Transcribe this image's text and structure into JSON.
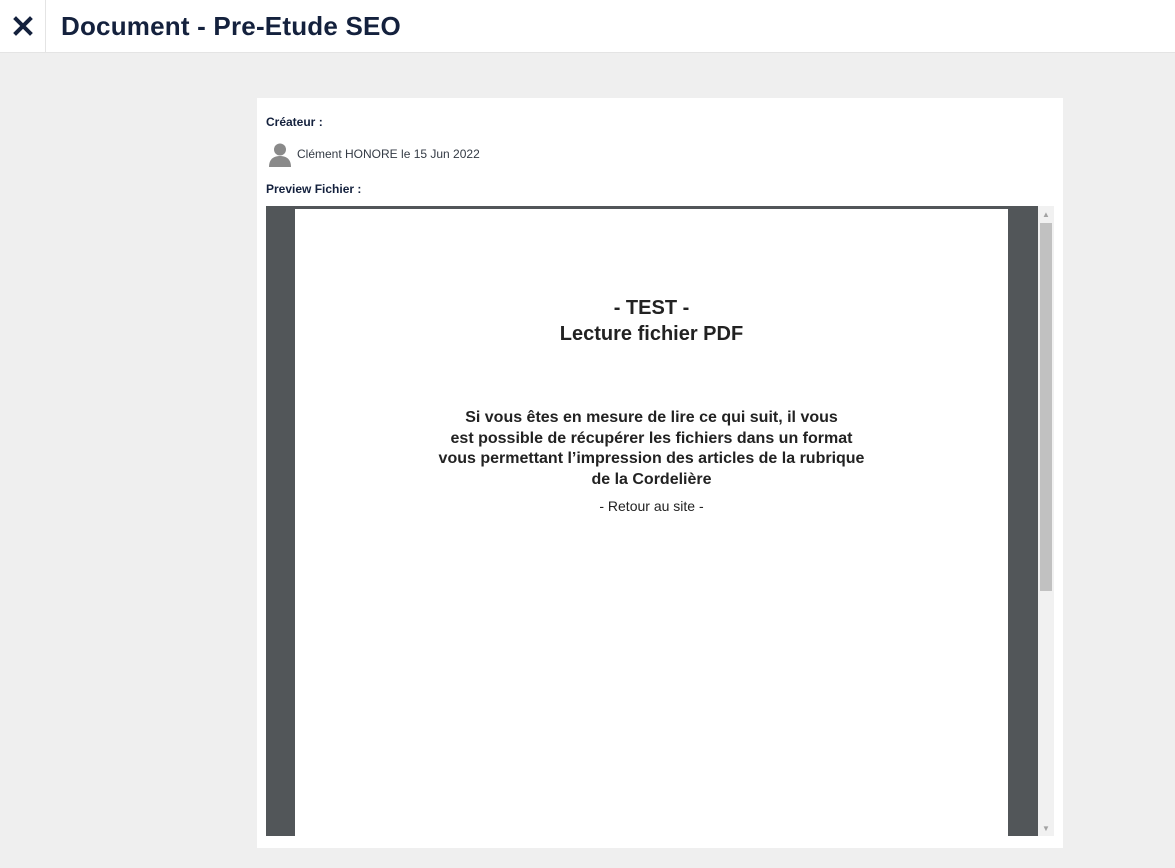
{
  "header": {
    "title": "Document - Pre-Etude SEO",
    "close_icon": "close-icon"
  },
  "card": {
    "creator_label": "Créateur :",
    "creator_text": "Clément HONORE le 15 Jun 2022",
    "avatar_icon": "user-avatar-icon",
    "preview_label": "Preview Fichier :"
  },
  "pdf": {
    "title_line1": "- TEST -",
    "title_line2": "Lecture fichier PDF",
    "body_line1": "Si vous êtes en mesure de lire ce qui suit, il vous",
    "body_line2": "est possible de récupérer les fichiers dans un format",
    "body_line3": "vous permettant l’impression des articles de la rubrique",
    "body_line4": "de la Cordelière",
    "link": "- Retour au site -"
  },
  "scrollbar": {
    "up_glyph": "▲",
    "down_glyph": "▼"
  },
  "colors": {
    "title": "#14213d",
    "background": "#efefef",
    "viewer": "#525659"
  }
}
